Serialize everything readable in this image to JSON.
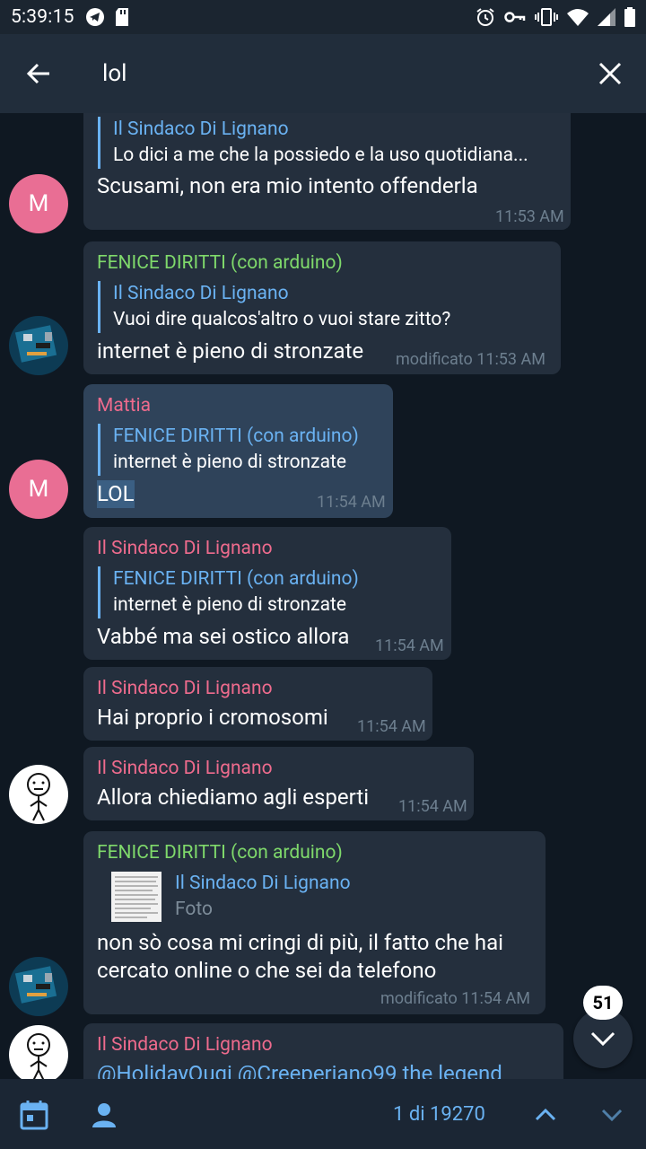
{
  "statusbar": {
    "time": "5:39:15"
  },
  "toolbar": {
    "query": "lol"
  },
  "messages": [
    {
      "reply_name": "Il Sindaco Di Lignano",
      "reply_text": "Lo dici a me che la possiedo e la uso quotidiana...",
      "text": "Scusami, non era mio intento offenderla",
      "meta": "11:53 AM",
      "avatar": "M"
    },
    {
      "sender": "FENICE DIRITTI (con arduino)",
      "reply_name": "Il Sindaco Di Lignano",
      "reply_text": "Vuoi dire qualcos'altro o vuoi stare zitto?",
      "text": "internet è pieno di stronzate",
      "meta": "modificato 11:53 AM"
    },
    {
      "sender": "Mattia",
      "reply_name": "FENICE DIRITTI (con arduino)",
      "reply_text": "internet è pieno di stronzate",
      "text": "LOL",
      "meta": "11:54 AM",
      "avatar": "M"
    },
    {
      "sender": "Il Sindaco Di Lignano",
      "reply_name": "FENICE DIRITTI (con arduino)",
      "reply_text": "internet è pieno di stronzate",
      "text": "Vabbé ma sei ostico allora",
      "meta": "11:54 AM"
    },
    {
      "sender": "Il Sindaco Di Lignano",
      "text": "Hai proprio i cromosomi",
      "meta": "11:54 AM"
    },
    {
      "sender": "Il Sindaco Di Lignano",
      "text": "Allora chiediamo agli esperti",
      "meta": "11:54 AM"
    },
    {
      "sender": "FENICE DIRITTI (con arduino)",
      "reply_name": "Il Sindaco Di Lignano",
      "reply_text": "Foto",
      "text_line1": "non sò cosa mi cringi di più, il fatto che hai",
      "text_line2": "cercato online o che sei da telefono",
      "meta": "modificato 11:54 AM"
    },
    {
      "sender": "Il Sindaco Di Lignano",
      "text": "@HolidayOugi @Creeperiano99 the legend"
    }
  ],
  "fab": {
    "badge": "51"
  },
  "bottombar": {
    "counter": "1 di 19270"
  },
  "colors": {
    "accent_blue": "#6ab2f2",
    "name_green": "#7fd96b",
    "name_pink": "#ee6b8d",
    "bubble": "#242f3d",
    "bubble_highlight": "#2f435a",
    "background": "#0f1822"
  }
}
